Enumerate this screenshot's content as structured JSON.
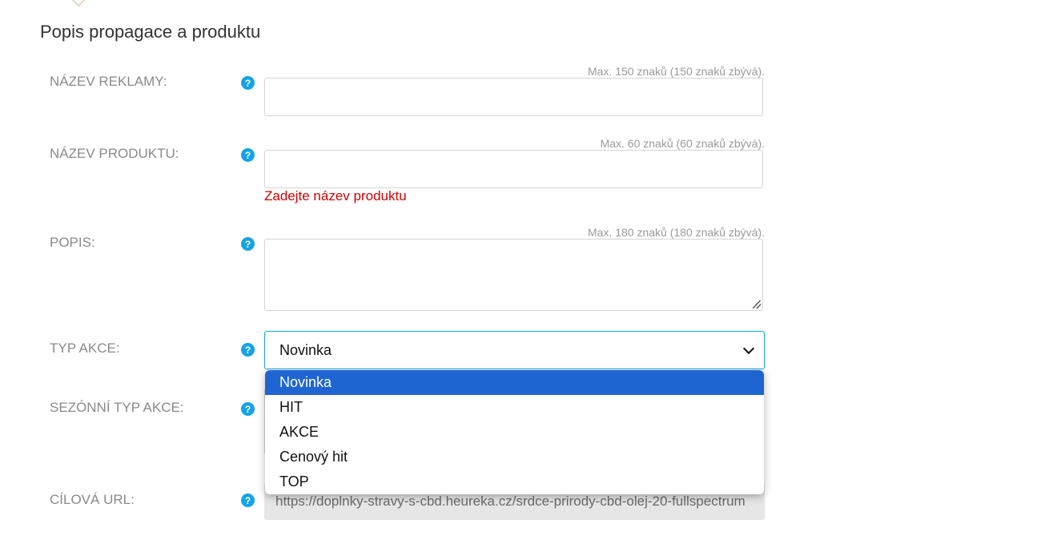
{
  "section": {
    "title": "Popis propagace a produktu"
  },
  "fields": {
    "ad_name": {
      "label": "NÁZEV REKLAMY:",
      "counter": "Max. 150 znaků (150 znaků zbývá).",
      "value": ""
    },
    "product_name": {
      "label": "NÁZEV PRODUKTU:",
      "counter": "Max. 60 znaků (60 znaků zbývá).",
      "value": "",
      "error": "Zadejte název produktu"
    },
    "description": {
      "label": "POPIS:",
      "counter": "Max. 180 znaků (180 znaků zbývá).",
      "value": ""
    },
    "action_type": {
      "label": "TYP AKCE:",
      "selected": "Novinka",
      "options": [
        "Novinka",
        "HIT",
        "AKCE",
        "Cenový hit",
        "TOP"
      ]
    },
    "seasonal_action_type": {
      "label": "SEZÓNNÍ TYP AKCE:"
    },
    "target_url": {
      "label": "CÍLOVÁ URL:",
      "value": "https://doplnky-stravy-s-cbd.heureka.cz/srdce-prirody-cbd-olej-20-fullspectrum"
    }
  },
  "help_icon_glyph": "?",
  "colors": {
    "help_icon": "#14a3e6",
    "error": "#d40000",
    "selected_option": "#1f65d1",
    "focus_border": "#14a3e6"
  }
}
